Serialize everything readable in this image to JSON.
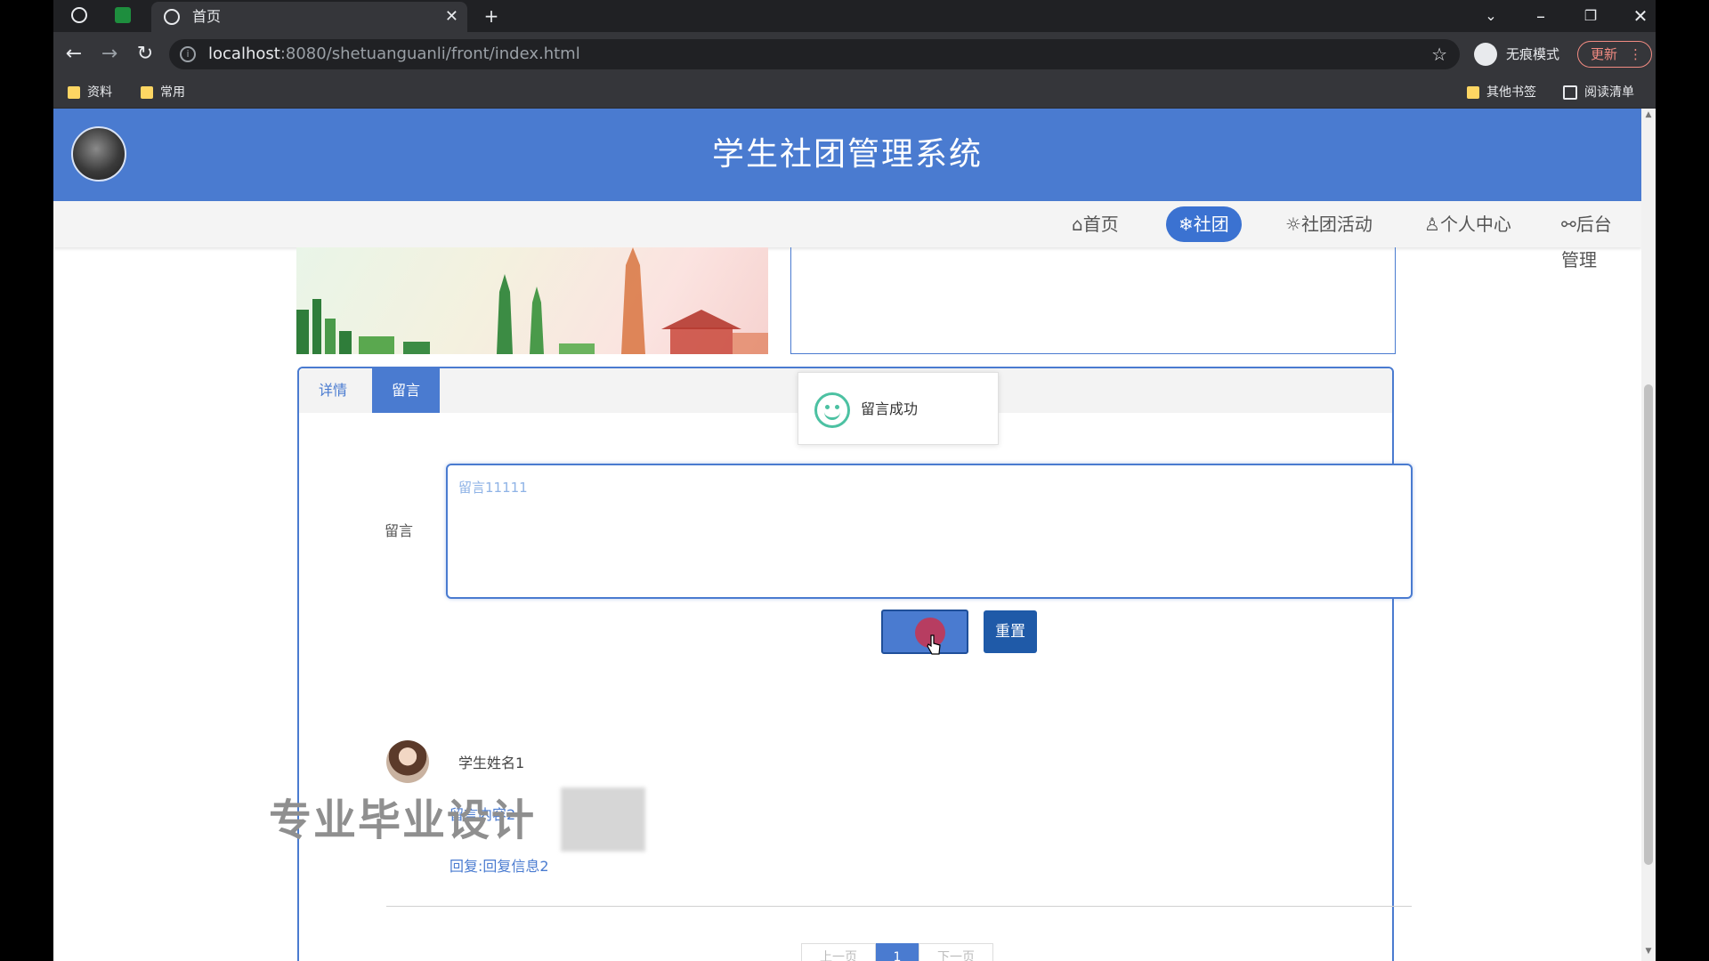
{
  "browser": {
    "tab_title": "首页",
    "url_host": "localhost",
    "url_rest": ":8080/shetuanguanli/front/index.html",
    "incognito_label": "无痕模式",
    "update_label": "更新",
    "bookmarks": [
      "资料",
      "常用"
    ],
    "other_bookmarks": "其他书签",
    "reading_list": "阅读清单"
  },
  "site": {
    "title": "学生社团管理系统",
    "nav": [
      {
        "icon": "⌂",
        "label": "首页"
      },
      {
        "icon": "❄",
        "label": "社团"
      },
      {
        "icon": "☼",
        "label": "社团活动"
      },
      {
        "icon": "♙",
        "label": "个人中心"
      },
      {
        "icon": "⚯",
        "label": "后台管理"
      }
    ],
    "active_nav": "社团"
  },
  "detail": {
    "tabs": [
      "详情",
      "留言"
    ],
    "active_tab": "留言",
    "toast": "留言成功",
    "form_label": "留言",
    "input_value": "",
    "input_placeholder": "留言11111",
    "reset_label": "重置"
  },
  "comments": [
    {
      "author": "学生姓名1",
      "reply_partial": "留言内容2",
      "reply": "回复:回复信息2"
    }
  ],
  "watermark": "专业毕业设计",
  "pagination": {
    "prev": "上一页",
    "current": "1",
    "next": "下一页"
  },
  "colors": {
    "primary": "#4a7bd0",
    "dark_button": "#1f5aa8",
    "toast_icon": "#4cc1a2"
  }
}
